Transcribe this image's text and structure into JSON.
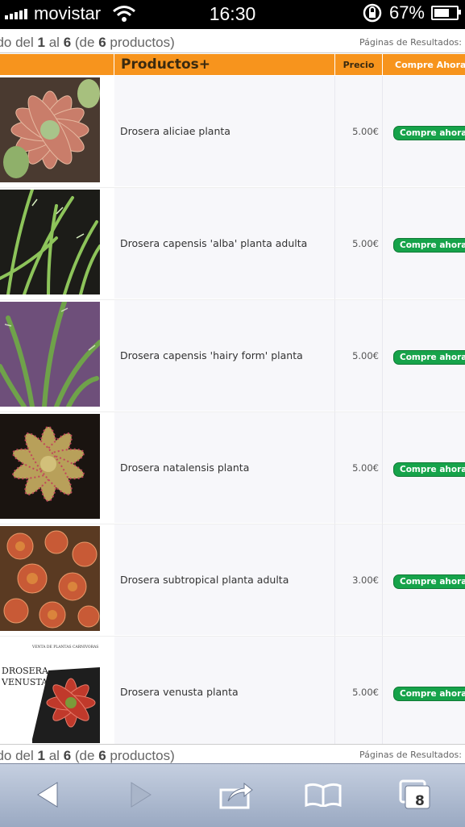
{
  "status_bar": {
    "carrier": "movistar",
    "time": "16:30",
    "battery": "67%"
  },
  "pager": {
    "prefix": "ndo del",
    "from": "1",
    "mid": "al",
    "to": "6",
    "open": "(de",
    "total": "6",
    "suffix": "productos)",
    "pages_label": "Páginas de Resultados:"
  },
  "table": {
    "headers": {
      "product": "Productos+",
      "price": "Precio",
      "buy": "Compre Ahora"
    },
    "rows": [
      {
        "name": "Drosera aliciae planta",
        "price": "5.00€",
        "button": "Compre ahora"
      },
      {
        "name": "Drosera capensis 'alba' planta adulta",
        "price": "5.00€",
        "button": "Compre ahora"
      },
      {
        "name": "Drosera capensis 'hairy form' planta",
        "price": "5.00€",
        "button": "Compre ahora"
      },
      {
        "name": "Drosera natalensis planta",
        "price": "5.00€",
        "button": "Compre ahora"
      },
      {
        "name": "Drosera subtropical planta adulta",
        "price": "3.00€",
        "button": "Compre ahora"
      },
      {
        "name": "Drosera venusta planta",
        "price": "5.00€",
        "button": "Compre ahora"
      }
    ]
  },
  "image_text": {
    "venusta_line1": "DROSERA",
    "venusta_line2": "VENUSTA",
    "venusta_small": "VENTA DE PLANTAS CARNIVORAS"
  },
  "toolbar": {
    "tabs_count": "8"
  },
  "colors": {
    "header_orange": "#f7941d",
    "buy_green": "#16a34a"
  }
}
